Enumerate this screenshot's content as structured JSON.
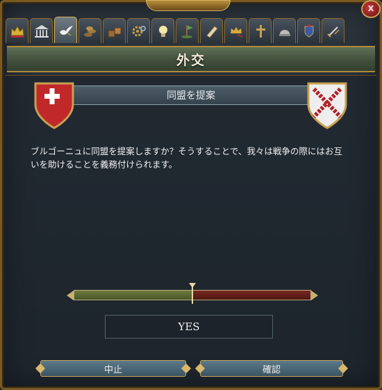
{
  "window": {
    "title": "外交",
    "close_label": "x"
  },
  "tabs": [
    {
      "icon": "crown-icon"
    },
    {
      "icon": "court-icon"
    },
    {
      "icon": "dove-icon",
      "active": true
    },
    {
      "icon": "coins-icon"
    },
    {
      "icon": "crates-icon"
    },
    {
      "icon": "gear-icon"
    },
    {
      "icon": "lightbulb-icon"
    },
    {
      "icon": "flag-icon"
    },
    {
      "icon": "scroll-icon"
    },
    {
      "icon": "crown-rival-icon"
    },
    {
      "icon": "cross-icon"
    },
    {
      "icon": "helmet-icon"
    },
    {
      "icon": "coat-of-arms-icon"
    },
    {
      "icon": "sword-icon"
    }
  ],
  "proposal": {
    "title": "同盟を提案",
    "description": "ブルゴーニュに同盟を提案しますか？そうすることで、我々は戦争の際にはお互いを助けることを義務付けられます。",
    "left_shield_color": "#c0282a",
    "right_shield_color": "#eeeeee",
    "right_cross_color": "#b22025"
  },
  "opinion": {
    "positive_fraction": 0.5
  },
  "result": {
    "text": "YES"
  },
  "buttons": {
    "cancel": "中止",
    "confirm": "確認"
  }
}
